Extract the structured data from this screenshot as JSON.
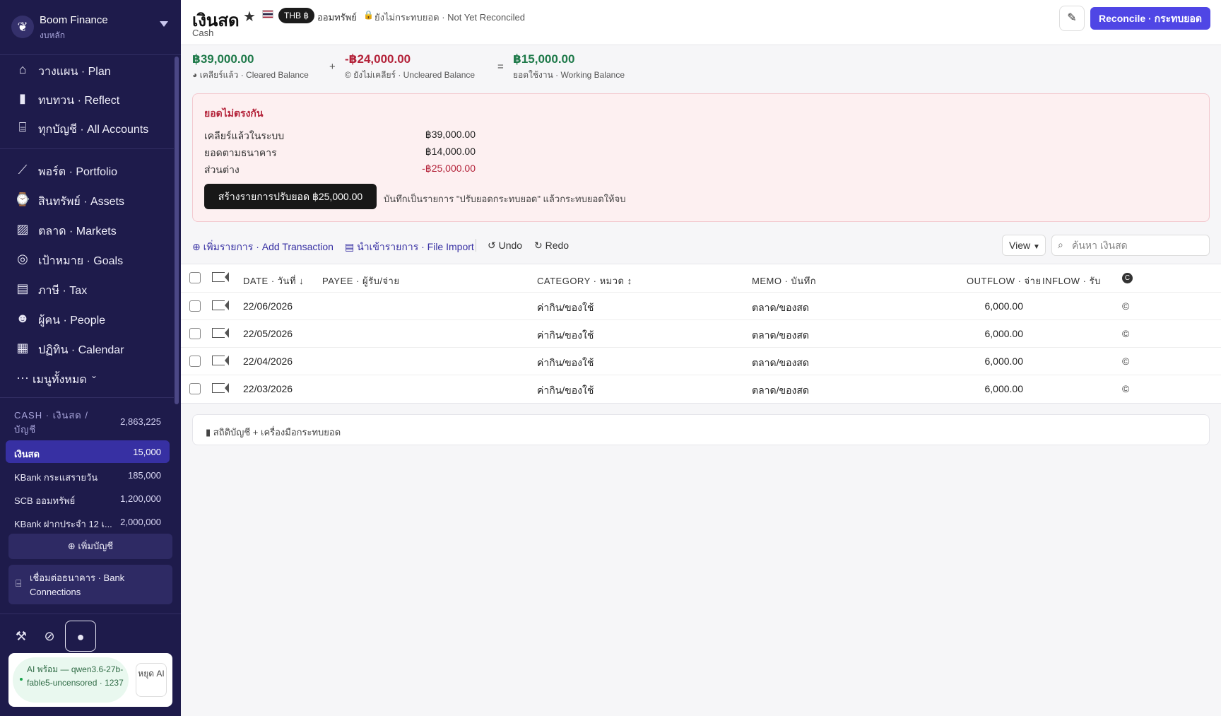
{
  "brand": {
    "name": "Boom Finance",
    "subtitle": "งบหลัก",
    "logo_icon": "tree-icon"
  },
  "nav": {
    "primary": [
      {
        "label": "วางแผน · Plan",
        "icon": "plan-icon"
      },
      {
        "label": "ทบทวน · Reflect",
        "icon": "bar-chart-icon"
      },
      {
        "label": "ทุกบัญชี · All Accounts",
        "icon": "bank-icon"
      }
    ],
    "secondary": [
      {
        "label": "พอร์ต · Portfolio",
        "icon": "line-chart-icon"
      },
      {
        "label": "สินทรัพย์ · Assets",
        "icon": "watch-icon"
      },
      {
        "label": "ตลาด · Markets",
        "icon": "image-icon"
      },
      {
        "label": "เป้าหมาย · Goals",
        "icon": "target-icon"
      },
      {
        "label": "ภาษี · Tax",
        "icon": "document-icon"
      },
      {
        "label": "ผู้คน · People",
        "icon": "people-icon"
      },
      {
        "label": "ปฏิทิน · Calendar",
        "icon": "calendar-icon"
      }
    ],
    "all_menus": "เมนูทั้งหมด"
  },
  "accounts": {
    "group_label": "CASH · เงินสด / บัญชี",
    "group_total": "2,863,225",
    "items": [
      {
        "name": "เงินสด",
        "value": "15,000",
        "active": true
      },
      {
        "name": "KBank กระแสรายวัน",
        "value": "185,000",
        "active": false
      },
      {
        "name": "SCB ออมทรัพย์",
        "value": "1,200,000",
        "active": false
      },
      {
        "name": "KBank ฝากประจำ 12 เ...",
        "value": "2,000,000",
        "active": false
      }
    ],
    "add_label": "เพิ่มบัญชี",
    "bank_connections_label": "เชื่อมต่อธนาคาร · Bank Connections"
  },
  "footer": {
    "ai_status": "AI พร้อม — qwen3.6-27b-fable5-uncensored · 1237",
    "ai_stop": "หยุด AI"
  },
  "header": {
    "title": "เงินสด",
    "currency_badge": "THB ฿",
    "account_type": "ออมทรัพย์",
    "reconcile_status": "ยังไม่กระทบยอด · Not Yet Reconciled",
    "subtitle": "Cash",
    "reconcile_button": "Reconcile · กระทบยอด"
  },
  "balances": {
    "cleared": {
      "amount": "฿39,000.00",
      "label": "เคลียร์แล้ว · Cleared Balance"
    },
    "uncleared": {
      "amount": "-฿24,000.00",
      "label": "ยังไม่เคลียร์ · Uncleared Balance"
    },
    "working": {
      "amount": "฿15,000.00",
      "label": "ยอดใช้งาน · Working Balance"
    },
    "plus_op": "+",
    "equals_op": "="
  },
  "mismatch": {
    "title": "ยอดไม่ตรงกัน",
    "rows": [
      {
        "label": "เคลียร์แล้วในระบบ",
        "value": "฿39,000.00"
      },
      {
        "label": "ยอดตามธนาคาร",
        "value": "฿14,000.00"
      },
      {
        "label": "ส่วนต่าง",
        "value": "-฿25,000.00"
      }
    ],
    "button": "สร้างรายการปรับยอด ฿25,000.00",
    "note": "บันทึกเป็นรายการ \"ปรับยอดกระทบยอด\" แล้วกระทบยอดให้จบ"
  },
  "toolbar": {
    "add_transaction": "เพิ่มรายการ · Add Transaction",
    "file_import": "นำเข้ารายการ · File Import",
    "undo": "Undo",
    "redo": "Redo",
    "view": "View",
    "search_placeholder": "ค้นหา เงินสด"
  },
  "table": {
    "headers": {
      "date": "DATE · วันที่ ↓",
      "payee": "PAYEE · ผู้รับ/จ่าย",
      "category": "CATEGORY · หมวด ↕",
      "memo": "MEMO · บันทึก",
      "outflow": "OUTFLOW · จ่าย",
      "inflow": "INFLOW · รับ"
    },
    "rows": [
      {
        "date": "22/06/2026",
        "payee": "",
        "category": "ค่ากิน/ของใช้",
        "memo": "ตลาด/ของสด",
        "outflow": "6,000.00",
        "inflow": ""
      },
      {
        "date": "22/05/2026",
        "payee": "",
        "category": "ค่ากิน/ของใช้",
        "memo": "ตลาด/ของสด",
        "outflow": "6,000.00",
        "inflow": ""
      },
      {
        "date": "22/04/2026",
        "payee": "",
        "category": "ค่ากิน/ของใช้",
        "memo": "ตลาด/ของสด",
        "outflow": "6,000.00",
        "inflow": ""
      },
      {
        "date": "22/03/2026",
        "payee": "",
        "category": "ค่ากิน/ของใช้",
        "memo": "ตลาด/ของสด",
        "outflow": "6,000.00",
        "inflow": ""
      }
    ]
  },
  "stats_bar": "สถิติบัญชี + เครื่องมือกระทบยอด",
  "colors": {
    "sidebar_bg": "#1e1b4b",
    "accent": "#4f46e5",
    "positive": "#1f7a4a",
    "negative": "#b4233a"
  }
}
